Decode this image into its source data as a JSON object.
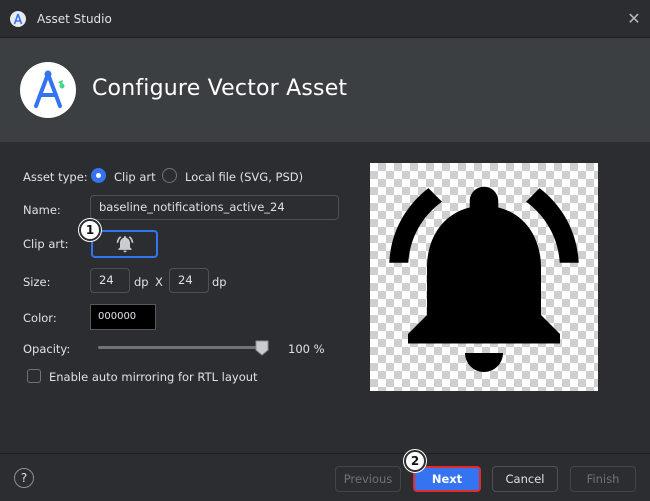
{
  "window": {
    "title": "Asset Studio",
    "close_glyph": "✕"
  },
  "banner": {
    "heading": "Configure Vector Asset"
  },
  "form": {
    "asset_type_label": "Asset type:",
    "asset_type_options": [
      {
        "label": "Clip art",
        "selected": true
      },
      {
        "label": "Local file (SVG, PSD)",
        "selected": false
      }
    ],
    "name_label": "Name:",
    "name_value": "baseline_notifications_active_24",
    "clip_art_label": "Clip art:",
    "clip_art_icon": "notifications-active-icon",
    "size_label": "Size:",
    "size_width": "24",
    "size_height": "24",
    "size_unit": "dp",
    "size_separator": "X",
    "color_label": "Color:",
    "color_value": "000000",
    "opacity_label": "Opacity:",
    "opacity_value": "100 %",
    "opacity_fraction": 1.0,
    "rtl_label": "Enable auto mirroring for RTL layout",
    "rtl_checked": false
  },
  "preview": {
    "icon": "notifications-active-icon"
  },
  "markers": {
    "one": "1",
    "two": "2"
  },
  "footer": {
    "help_glyph": "?",
    "previous_label": "Previous",
    "next_label": "Next",
    "cancel_label": "Cancel",
    "finish_label": "Finish"
  },
  "colors": {
    "accent": "#3574f0",
    "highlight": "#e52a2a",
    "background": "#2b2d30",
    "banner": "#3c3f41"
  }
}
